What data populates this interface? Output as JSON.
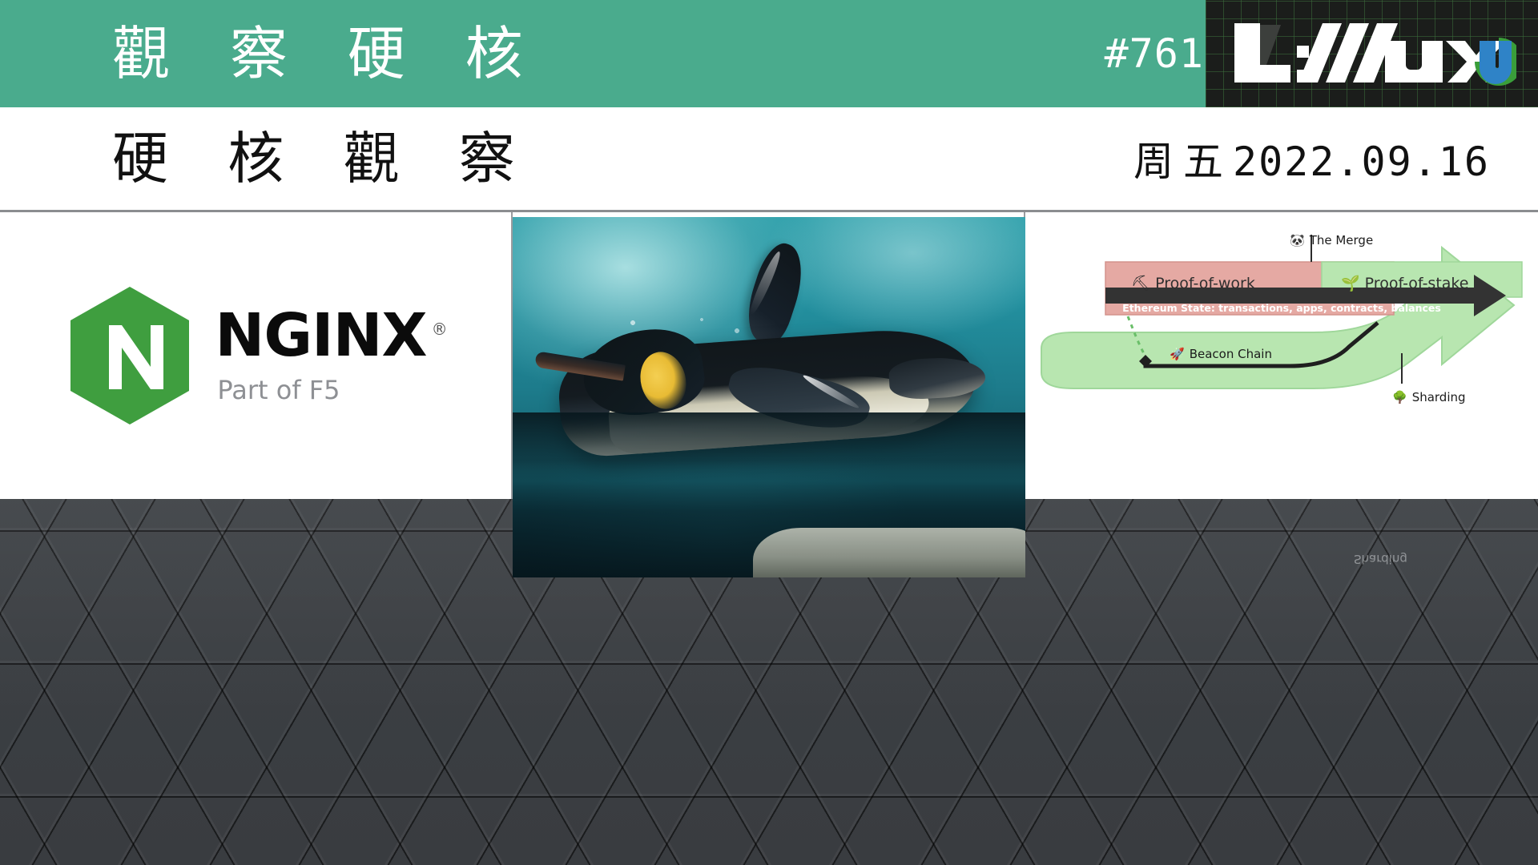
{
  "header": {
    "title": "觀 察 硬 核",
    "issue": "#761",
    "bg_color": "#4aab8d",
    "logo": {
      "name": "linuxcn-logo",
      "word_main": "L://ux",
      "word_cn": "cn",
      "color_white": "#ffffff",
      "color_green": "#3a9e3a",
      "color_blue": "#2f83c7",
      "color_red": "#e03020",
      "bg": "#1b1d1b"
    }
  },
  "subheader": {
    "title": "硬 核 觀 察",
    "weekday": "周五",
    "date": "2022.09.16"
  },
  "cards": [
    {
      "name": "nginx-card",
      "kind": "logo",
      "brand": "NGINX",
      "registered_mark": "®",
      "tagline": "Part of F5",
      "hex_color": "#3f9e3f",
      "letter": "N",
      "text_color": "#0b0b0b",
      "tagline_color": "#8e9094"
    },
    {
      "name": "penguin-card",
      "kind": "photo",
      "subject": "emperor-penguin-underwater",
      "water_color": "#1d7b8b"
    },
    {
      "name": "ethereum-merge-card",
      "kind": "diagram",
      "diagram": {
        "title_merge": "The Merge",
        "merge_icon": "panda-icon",
        "left_track": "Proof-of-work",
        "left_icon": "pickaxe-icon",
        "left_color": "#e5a9a3",
        "right_track": "Proof-of-stake",
        "right_icon": "seedling-icon",
        "right_color": "#b8e6b0",
        "state_bar": "Ethereum State: transactions, apps, contracts, balances",
        "state_bar_color": "#333333",
        "beacon_chain": "Beacon Chain",
        "beacon_icon": "rocket-icon",
        "sharding": "Sharding",
        "sharding_icon": "tree-icon"
      }
    }
  ],
  "background": {
    "name": "hexagon-texture",
    "base_color": "#44474b"
  },
  "reflection": {
    "sharding_mirror": "Sharding"
  }
}
